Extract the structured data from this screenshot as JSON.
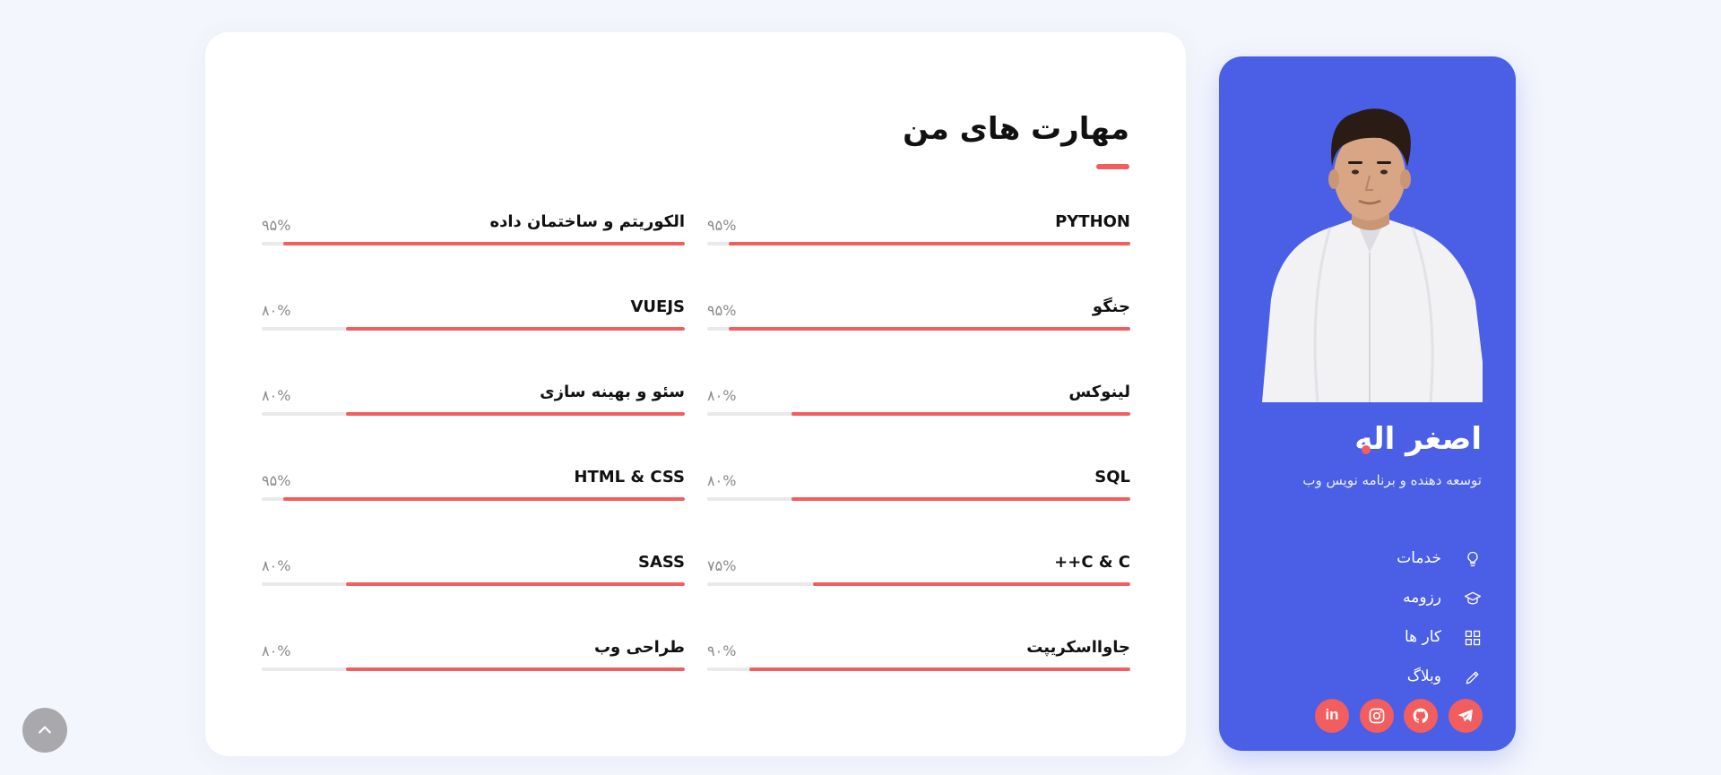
{
  "skills_section": {
    "title": "مهارت های من",
    "skills_right": [
      {
        "name": "PYTHON",
        "percent_text": "۹۵%",
        "level": 0.95
      },
      {
        "name": "جنگو",
        "percent_text": "۹۵%",
        "level": 0.95
      },
      {
        "name": "لینوکس",
        "percent_text": "۸۰%",
        "level": 0.8
      },
      {
        "name": "SQL",
        "percent_text": "۸۰%",
        "level": 0.8
      },
      {
        "name": "C & C++",
        "percent_text": "۷۵%",
        "level": 0.75
      },
      {
        "name": "جاوااسکریپت",
        "percent_text": "۹۰%",
        "level": 0.9
      }
    ],
    "skills_left": [
      {
        "name": "الکوریتم و ساختمان داده",
        "percent_text": "۹۵%",
        "level": 0.95
      },
      {
        "name": "VUEJS",
        "percent_text": "۸۰%",
        "level": 0.8
      },
      {
        "name": "سئو و بهینه سازی",
        "percent_text": "۸۰%",
        "level": 0.8
      },
      {
        "name": "HTML & CSS",
        "percent_text": "۹۵%",
        "level": 0.95
      },
      {
        "name": "SASS",
        "percent_text": "۸۰%",
        "level": 0.8
      },
      {
        "name": "طراحی وب",
        "percent_text": "۸۰%",
        "level": 0.8
      }
    ]
  },
  "profile": {
    "name": "اصغر اله",
    "subtitle": "توسعه دهنده و برنامه نویس وب",
    "nav": [
      {
        "label": "خدمات",
        "icon": "lightbulb-icon"
      },
      {
        "label": "رزومه",
        "icon": "graduation-cap-icon"
      },
      {
        "label": "کار ها",
        "icon": "grid-icon"
      },
      {
        "label": "وبلاگ",
        "icon": "pencil-icon"
      }
    ],
    "socials": [
      "telegram-icon",
      "github-icon",
      "instagram-icon",
      "linkedin-icon"
    ]
  },
  "colors": {
    "accent": "#f25d5d",
    "profile_bg": "#4b5fe6",
    "page_bg": "#f4f6fd"
  }
}
